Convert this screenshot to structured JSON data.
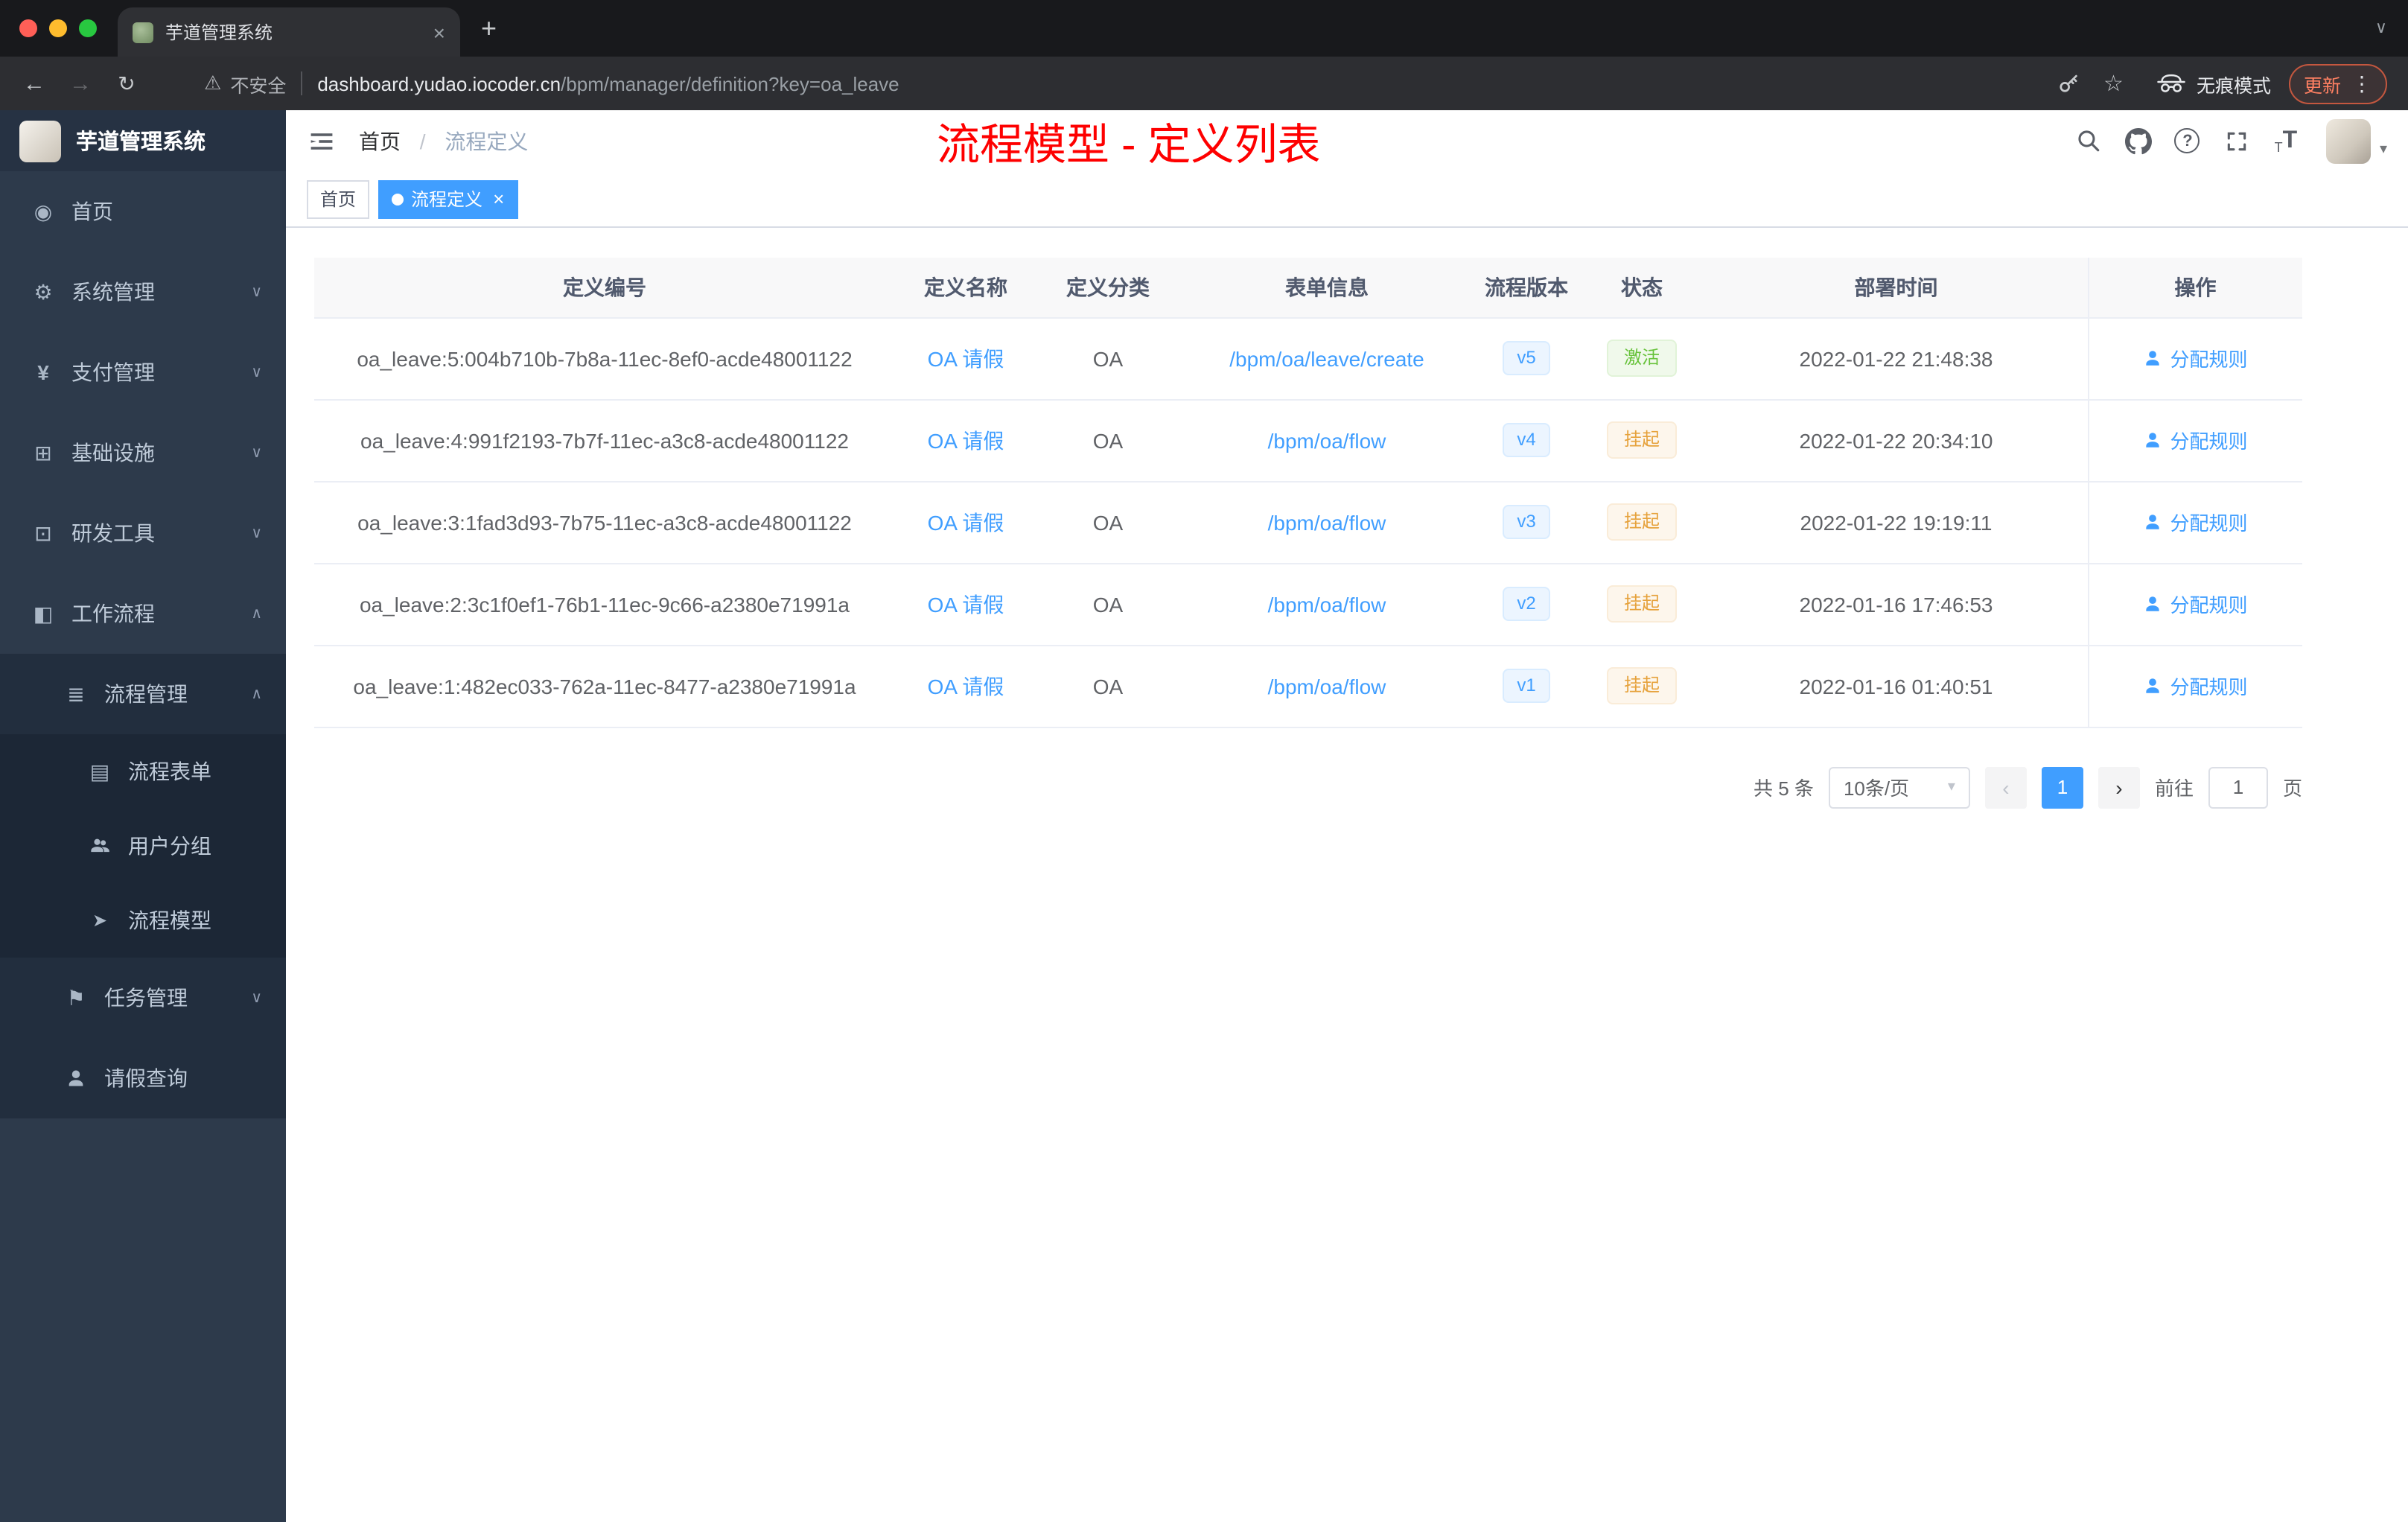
{
  "browser": {
    "tab": {
      "title": "芋道管理系统"
    },
    "toolbar": {
      "security_label": "不安全",
      "url_domain": "dashboard.yudao.iocoder.cn",
      "url_path": "/bpm/manager/definition?key=oa_leave",
      "incognito_label": "无痕模式",
      "update_label": "更新"
    }
  },
  "sidebar": {
    "logo_title": "芋道管理系统",
    "items": [
      {
        "label": "首页",
        "icon": "dashboard-icon",
        "level": 1
      },
      {
        "label": "系统管理",
        "icon": "gear-icon",
        "level": 1,
        "chevron": "down"
      },
      {
        "label": "支付管理",
        "icon": "yen-icon",
        "level": 1,
        "chevron": "down"
      },
      {
        "label": "基础设施",
        "icon": "infrastructure-icon",
        "level": 1,
        "chevron": "down"
      },
      {
        "label": "研发工具",
        "icon": "dev-tools-icon",
        "level": 1,
        "chevron": "down"
      },
      {
        "label": "工作流程",
        "icon": "workflow-icon",
        "level": 1,
        "chevron": "up"
      },
      {
        "label": "流程管理",
        "icon": "list-icon",
        "level": 2,
        "chevron": "up"
      },
      {
        "label": "流程表单",
        "icon": "form-icon",
        "level": 3
      },
      {
        "label": "用户分组",
        "icon": "user-group-icon",
        "level": 3
      },
      {
        "label": "流程模型",
        "icon": "send-icon",
        "level": 3
      },
      {
        "label": "任务管理",
        "icon": "tasks-icon",
        "level": 2,
        "chevron": "down"
      },
      {
        "label": "请假查询",
        "icon": "user-icon",
        "level": 2
      }
    ]
  },
  "header": {
    "breadcrumb": {
      "root": "首页",
      "separator": "/",
      "current": "流程定义"
    },
    "overlay_title": "流程模型 - 定义列表",
    "icons": [
      "search-icon",
      "github-icon",
      "help-icon",
      "fullscreen-icon",
      "font-size-icon",
      "avatar",
      "chevron-down-icon"
    ]
  },
  "tags": {
    "items": [
      {
        "label": "首页",
        "active": false
      },
      {
        "label": "流程定义",
        "active": true,
        "closable": true
      }
    ]
  },
  "table": {
    "headers": [
      "定义编号",
      "定义名称",
      "定义分类",
      "表单信息",
      "流程版本",
      "状态",
      "部署时间",
      "操作"
    ],
    "rows": [
      {
        "id": "oa_leave:5:004b710b-7b8a-11ec-8ef0-acde48001122",
        "name": "OA 请假",
        "category": "OA",
        "form": "/bpm/oa/leave/create",
        "version": "v5",
        "status": "激活",
        "status_type": "success",
        "deploy_time": "2022-01-22 21:48:38",
        "action": "分配规则"
      },
      {
        "id": "oa_leave:4:991f2193-7b7f-11ec-a3c8-acde48001122",
        "name": "OA 请假",
        "category": "OA",
        "form": "/bpm/oa/flow",
        "version": "v4",
        "status": "挂起",
        "status_type": "warning",
        "deploy_time": "2022-01-22 20:34:10",
        "action": "分配规则"
      },
      {
        "id": "oa_leave:3:1fad3d93-7b75-11ec-a3c8-acde48001122",
        "name": "OA 请假",
        "category": "OA",
        "form": "/bpm/oa/flow",
        "version": "v3",
        "status": "挂起",
        "status_type": "warning",
        "deploy_time": "2022-01-22 19:19:11",
        "action": "分配规则"
      },
      {
        "id": "oa_leave:2:3c1f0ef1-76b1-11ec-9c66-a2380e71991a",
        "name": "OA 请假",
        "category": "OA",
        "form": "/bpm/oa/flow",
        "version": "v2",
        "status": "挂起",
        "status_type": "warning",
        "deploy_time": "2022-01-16 17:46:53",
        "action": "分配规则"
      },
      {
        "id": "oa_leave:1:482ec033-762a-11ec-8477-a2380e71991a",
        "name": "OA 请假",
        "category": "OA",
        "form": "/bpm/oa/flow",
        "version": "v1",
        "status": "挂起",
        "status_type": "warning",
        "deploy_time": "2022-01-16 01:40:51",
        "action": "分配规则"
      }
    ]
  },
  "pagination": {
    "total": "共 5 条",
    "page_size": "10条/页",
    "current_page": "1",
    "goto_label": "前往",
    "goto_value": "1",
    "unit_label": "页"
  },
  "colors": {
    "accent": "#409eff",
    "success": "#67c23a",
    "warning": "#e6a23c",
    "annotation_red": "#fe0000",
    "sidebar_bg": "#2d3a4b",
    "sidebar_submenu_bg": "#1c2736"
  }
}
